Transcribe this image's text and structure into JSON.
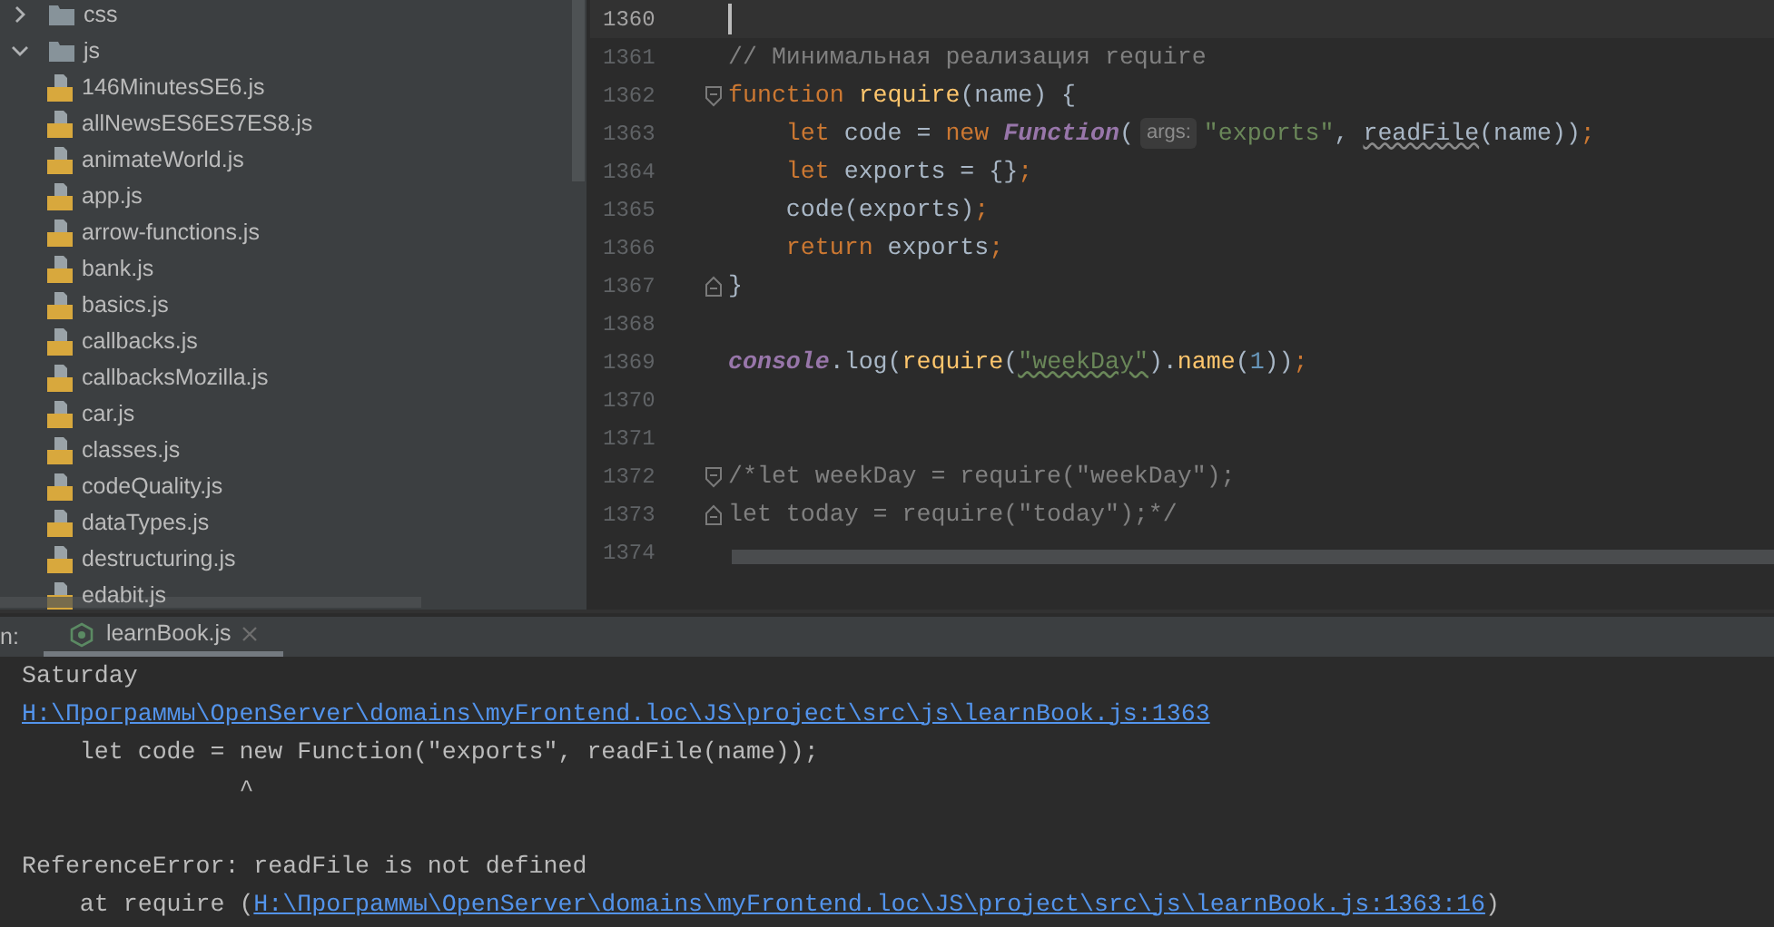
{
  "project_tree": [
    {
      "name": "css",
      "kind": "folder",
      "expanded": false
    },
    {
      "name": "js",
      "kind": "folder",
      "expanded": true,
      "children": [
        {
          "name": "146MinutesSE6.js",
          "kind": "file"
        },
        {
          "name": "allNewsES6ES7ES8.js",
          "kind": "file"
        },
        {
          "name": "animateWorld.js",
          "kind": "file"
        },
        {
          "name": "app.js",
          "kind": "file"
        },
        {
          "name": "arrow-functions.js",
          "kind": "file"
        },
        {
          "name": "bank.js",
          "kind": "file"
        },
        {
          "name": "basics.js",
          "kind": "file"
        },
        {
          "name": "callbacks.js",
          "kind": "file"
        },
        {
          "name": "callbacksMozilla.js",
          "kind": "file"
        },
        {
          "name": "car.js",
          "kind": "file"
        },
        {
          "name": "classes.js",
          "kind": "file"
        },
        {
          "name": "codeQuality.js",
          "kind": "file"
        },
        {
          "name": "dataTypes.js",
          "kind": "file"
        },
        {
          "name": "destructuring.js",
          "kind": "file"
        },
        {
          "name": "edabit.js",
          "kind": "file"
        }
      ]
    }
  ],
  "editor": {
    "lines": [
      {
        "number": "1360",
        "current": true
      },
      {
        "number": "1361",
        "current": false,
        "segments": [
          {
            "text": "// Минимальная реализация require",
            "kind": "comment"
          }
        ]
      },
      {
        "number": "1362",
        "current": false,
        "fold_start": true,
        "segments": [
          {
            "text": "function ",
            "kind": "keyword"
          },
          {
            "text": "require",
            "kind": "function"
          },
          {
            "text": "(name) {",
            "kind": "plain"
          }
        ]
      },
      {
        "number": "1363",
        "current": false,
        "segments": [
          {
            "text": "    let",
            "kind": "keyword"
          },
          {
            "text": " code = ",
            "kind": "plain"
          },
          {
            "text": "new ",
            "kind": "keyword"
          },
          {
            "text": "Function",
            "kind": "class"
          },
          {
            "text": "(",
            "kind": "plain"
          },
          {
            "text": "args:",
            "kind": "hint"
          },
          {
            "text": "\"exports\"",
            "kind": "string"
          },
          {
            "text": ", ",
            "kind": "plain"
          },
          {
            "text": "readFile",
            "kind": "unresolved"
          },
          {
            "text": "(name))",
            "kind": "plain"
          },
          {
            "text": ";",
            "kind": "keyword"
          }
        ]
      },
      {
        "number": "1364",
        "current": false,
        "segments": [
          {
            "text": "    let",
            "kind": "keyword"
          },
          {
            "text": " exports = {}",
            "kind": "plain"
          },
          {
            "text": ";",
            "kind": "keyword"
          }
        ]
      },
      {
        "number": "1365",
        "current": false,
        "segments": [
          {
            "text": "    code(exports)",
            "kind": "plain"
          },
          {
            "text": ";",
            "kind": "keyword"
          }
        ]
      },
      {
        "number": "1366",
        "current": false,
        "segments": [
          {
            "text": "    return",
            "kind": "keyword"
          },
          {
            "text": " exports",
            "kind": "plain"
          },
          {
            "text": ";",
            "kind": "keyword"
          }
        ]
      },
      {
        "number": "1367",
        "current": false,
        "fold_end": true,
        "segments": [
          {
            "text": "}",
            "kind": "plain"
          }
        ]
      },
      {
        "number": "1368",
        "current": false
      },
      {
        "number": "1369",
        "current": false,
        "segments": [
          {
            "text": "console",
            "kind": "global"
          },
          {
            "text": ".log(",
            "kind": "plain"
          },
          {
            "text": "require",
            "kind": "function"
          },
          {
            "text": "(",
            "kind": "plain"
          },
          {
            "text": "\"weekDay\"",
            "kind": "typo_string"
          },
          {
            "text": ").",
            "kind": "plain"
          },
          {
            "text": "name",
            "kind": "function"
          },
          {
            "text": "(",
            "kind": "plain"
          },
          {
            "text": "1",
            "kind": "number"
          },
          {
            "text": "))",
            "kind": "plain"
          },
          {
            "text": ";",
            "kind": "keyword"
          }
        ]
      },
      {
        "number": "1370",
        "current": false
      },
      {
        "number": "1371",
        "current": false
      },
      {
        "number": "1372",
        "current": false,
        "fold_start": true,
        "segments": [
          {
            "text": "/*let weekDay = require(\"weekDay\");",
            "kind": "comment"
          }
        ]
      },
      {
        "number": "1373",
        "current": false,
        "fold_end": true,
        "segments": [
          {
            "text": "let today = require(\"today\");*/",
            "kind": "comment"
          }
        ]
      },
      {
        "number": "1374",
        "current": false
      }
    ]
  },
  "run_panel": {
    "label": "n:",
    "tabs": [
      {
        "label": "learnBook.js",
        "selected": true
      }
    ],
    "console": [
      {
        "segments": [
          {
            "text": "Saturday",
            "kind": "text"
          }
        ]
      },
      {
        "segments": [
          {
            "text": "H:\\Программы\\OpenServer\\domains\\myFrontend.loc\\JS\\project\\src\\js\\learnBook.js:1363",
            "kind": "link"
          }
        ]
      },
      {
        "segments": [
          {
            "text": "    let code = new Function(\"exports\", readFile(name));",
            "kind": "text"
          }
        ]
      },
      {
        "segments": [
          {
            "text": "               ^",
            "kind": "text"
          }
        ]
      },
      {
        "blank_line_before": true,
        "segments": [
          {
            "text": "ReferenceError: readFile is not defined",
            "kind": "text"
          }
        ]
      },
      {
        "segments": [
          {
            "text": "    at require (",
            "kind": "text"
          },
          {
            "text": "H:\\Программы\\OpenServer\\domains\\myFrontend.loc\\JS\\project\\src\\js\\learnBook.js:1363:16",
            "kind": "link"
          },
          {
            "text": ")",
            "kind": "text"
          }
        ]
      }
    ]
  }
}
